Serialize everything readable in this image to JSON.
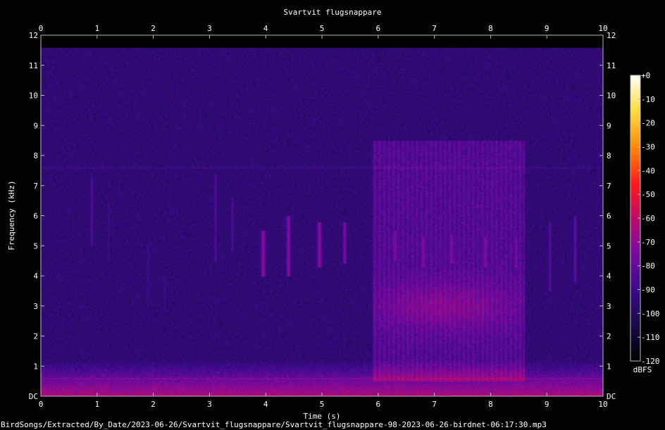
{
  "chart_data": {
    "type": "heatmap",
    "title": "Svartvit flugsnappare",
    "xlabel": "Time (s)",
    "ylabel": "Frequency (kHz)",
    "xlim": [
      0,
      10
    ],
    "ylim": [
      0,
      12
    ],
    "x_ticks": [
      "0",
      "1",
      "2",
      "3",
      "4",
      "5",
      "6",
      "7",
      "8",
      "9",
      "10"
    ],
    "y_ticks": [
      "DC",
      "1",
      "2",
      "3",
      "4",
      "5",
      "6",
      "7",
      "8",
      "9",
      "10",
      "11",
      "12"
    ],
    "colorbar": {
      "label": "dBFS",
      "range": [
        -120,
        0
      ],
      "ticks": [
        "+0",
        "-10",
        "-20",
        "-30",
        "-40",
        "-50",
        "-60",
        "-70",
        "-80",
        "-90",
        "-100",
        "-110",
        "-120"
      ],
      "colors": [
        "#000000",
        "#1a0a4a",
        "#3a0a8a",
        "#7a0aa0",
        "#c00a6a",
        "#ff1a1a",
        "#ff8a0a",
        "#ffe040",
        "#ffffff"
      ]
    },
    "noise_floor_dbfs": -95,
    "low_freq_band": {
      "freq_khz": [
        0,
        1.2
      ],
      "level_dbfs": -70
    },
    "loud_segment": {
      "t_s": [
        5.9,
        8.6
      ],
      "freq_khz": [
        0.5,
        8.5
      ],
      "level_dbfs": -80,
      "peak_freq_khz": 3.0,
      "peak_dbfs": -65
    },
    "calls": [
      {
        "t_s": 0.9,
        "f_low_khz": 5.0,
        "f_high_khz": 7.3,
        "dbfs": -85
      },
      {
        "t_s": 1.2,
        "f_low_khz": 4.5,
        "f_high_khz": 6.5,
        "dbfs": -90
      },
      {
        "t_s": 1.9,
        "f_low_khz": 3.0,
        "f_high_khz": 5.0,
        "dbfs": -90
      },
      {
        "t_s": 2.2,
        "f_low_khz": 2.8,
        "f_high_khz": 4.0,
        "dbfs": -90
      },
      {
        "t_s": 3.1,
        "f_low_khz": 4.5,
        "f_high_khz": 7.4,
        "dbfs": -85
      },
      {
        "t_s": 3.4,
        "f_low_khz": 4.8,
        "f_high_khz": 6.6,
        "dbfs": -85
      },
      {
        "t_s": 3.95,
        "f_low_khz": 4.0,
        "f_high_khz": 5.5,
        "dbfs": -70
      },
      {
        "t_s": 4.4,
        "f_low_khz": 4.0,
        "f_high_khz": 6.0,
        "dbfs": -72
      },
      {
        "t_s": 4.95,
        "f_low_khz": 4.3,
        "f_high_khz": 5.8,
        "dbfs": -70
      },
      {
        "t_s": 5.4,
        "f_low_khz": 4.4,
        "f_high_khz": 5.8,
        "dbfs": -75
      },
      {
        "t_s": 6.3,
        "f_low_khz": 4.5,
        "f_high_khz": 5.5,
        "dbfs": -72
      },
      {
        "t_s": 6.8,
        "f_low_khz": 4.3,
        "f_high_khz": 5.3,
        "dbfs": -72
      },
      {
        "t_s": 7.3,
        "f_low_khz": 4.4,
        "f_high_khz": 5.4,
        "dbfs": -72
      },
      {
        "t_s": 7.9,
        "f_low_khz": 4.3,
        "f_high_khz": 5.3,
        "dbfs": -72
      },
      {
        "t_s": 8.45,
        "f_low_khz": 4.3,
        "f_high_khz": 5.3,
        "dbfs": -75
      },
      {
        "t_s": 9.05,
        "f_low_khz": 3.5,
        "f_high_khz": 5.8,
        "dbfs": -82
      },
      {
        "t_s": 9.5,
        "f_low_khz": 3.8,
        "f_high_khz": 6.0,
        "dbfs": -80
      }
    ]
  },
  "footer": {
    "filename": "BirdSongs/Extracted/By_Date/2023-06-26/Svartvit_flugsnappare/Svartvit_flugsnappare-98-2023-06-26-birdnet-06:17:30.mp3"
  }
}
